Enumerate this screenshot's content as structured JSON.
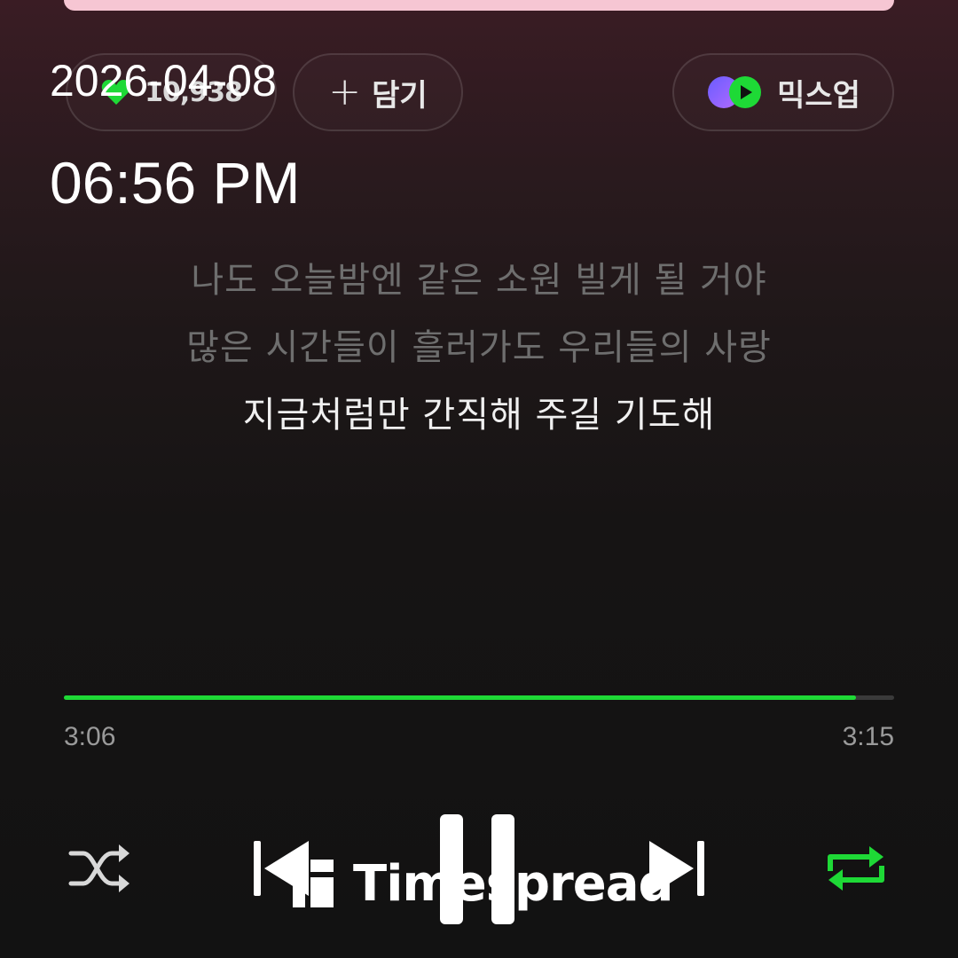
{
  "header": {
    "like_count": "10,938",
    "add_label": "담기",
    "mixup_label": "믹스업"
  },
  "overlay": {
    "date": "2026-04-08",
    "time": "06:56 PM"
  },
  "lyrics": [
    {
      "text": "나도 오늘밤엔 같은 소원 빌게 될 거야",
      "current": false
    },
    {
      "text": "많은 시간들이 흘러가도 우리들의 사랑",
      "current": false
    },
    {
      "text": "지금처럼만 간직해 주길 기도해",
      "current": true
    }
  ],
  "player": {
    "elapsed": "3:06",
    "total": "3:15",
    "progress_fraction": 0.954,
    "repeat_active": true,
    "state": "playing"
  },
  "controls": {
    "icons": [
      "shuffle-icon",
      "previous-icon",
      "pause-icon",
      "next-icon",
      "repeat-icon"
    ]
  },
  "watermark": {
    "text": "Timespread"
  },
  "colors": {
    "accent_green": "#1ed936",
    "banner_pink": "#f6c6d3",
    "lyric_dim": "#6e6e6e",
    "lyric_current": "#f0f0f0"
  }
}
